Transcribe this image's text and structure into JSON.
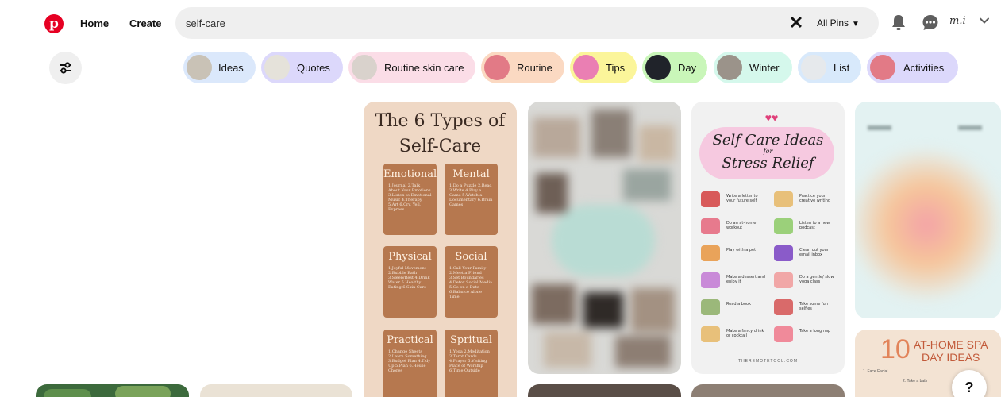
{
  "header": {
    "logo_letter": "p",
    "home_label": "Home",
    "create_label": "Create",
    "search": {
      "value": "self-care",
      "clear_icon": "close-icon"
    },
    "filter_select": "All Pins",
    "avatar_text": "m.i"
  },
  "chips": [
    {
      "label": "Ideas",
      "bg": "#dbe8fb",
      "thumb": "#c9c2b6"
    },
    {
      "label": "Quotes",
      "bg": "#dcd8fb",
      "thumb": "#e5e2da"
    },
    {
      "label": "Routine skin care",
      "bg": "#fbdde7",
      "thumb": "#d9d2cc"
    },
    {
      "label": "Routine",
      "bg": "#fbd9c2",
      "thumb": "#e27a86"
    },
    {
      "label": "Tips",
      "bg": "#fbf59a",
      "thumb": "#ea7fb3"
    },
    {
      "label": "Day",
      "bg": "#c9f6b9",
      "thumb": "#20232a"
    },
    {
      "label": "Winter",
      "bg": "#d5f8ec",
      "thumb": "#9b938a"
    },
    {
      "label": "List",
      "bg": "#d8e9fb",
      "thumb": "#e6e9ec"
    },
    {
      "label": "Activities",
      "bg": "#dcd8fb",
      "thumb": "#e27a86"
    }
  ],
  "pins": {
    "types": {
      "title_line1": "The 6 Types of",
      "title_line2": "Self-Care",
      "cells": [
        {
          "title": "Emotional",
          "items": "1.Journal 2.Talk About Your Emotions 3.Listen to Emotional Music 4.Therapy 5.Art 6.Cry, Yell, Express"
        },
        {
          "title": "Mental",
          "items": "1.Do a Puzzle 2.Read 3.Write 4.Play a Game 5.Watch a Documentary 6.Brain Games"
        },
        {
          "title": "Physical",
          "items": "1.Joyful Movement 2.Bubble Bath 3.Sleep/Rest 4.Drink Water 5.Healthy Eating 6.Skin Care"
        },
        {
          "title": "Social",
          "items": "1.Call Your Family 2.Meet a Friend 3.Set Boundaries 4.Detox Social Media 5.Go on a Date 6.Balance Alone Time"
        },
        {
          "title": "Practical",
          "items": "1.Change Sheets 2.Learn Something 3.Budget Plan 4.Tidy Up 5.Plan 6.House Chores"
        },
        {
          "title": "Spritual",
          "items": "1.Yoga 2.Meditation 3.Tarot Cards 4.Prayer 5.Visiting Place of Worship 6.Time Outside"
        }
      ]
    },
    "stress": {
      "title_line1": "Self Care Ideas",
      "title_for": "for",
      "title_line2": "Stress Relief",
      "left_items": [
        "Write a letter to your future self",
        "Do an at-home workout",
        "Play with a pet",
        "Make a dessert and enjoy it",
        "Read a book",
        "Make a fancy drink or cocktail"
      ],
      "right_items": [
        "Practice your creative writing",
        "Listen to a new podcast",
        "Clean out your email inbox",
        "Do a gentle/ slow yoga class",
        "Take some fun selfies",
        "Take a long nap"
      ],
      "footer": "THEREMOTETOOL.COM"
    },
    "spa": {
      "number": "10",
      "title_line1": "AT-HOME SPA",
      "title_line2": "DAY IDEAS",
      "item1": "1. Face Facial",
      "item2": "2. Take a bath"
    }
  },
  "help_label": "?",
  "colors": {
    "brand": "#e60023",
    "search_bg": "#efefef",
    "types_card": "#efd8c5",
    "types_cell": "#b6784f",
    "stress_card": "#f1f1f1",
    "spa_card": "#f3e3d3"
  }
}
